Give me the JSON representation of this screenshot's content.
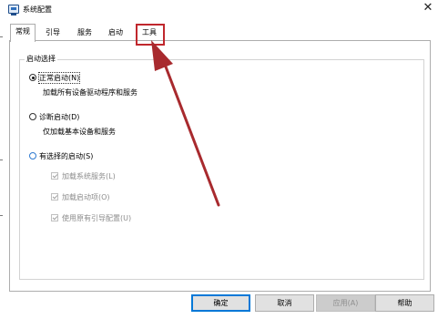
{
  "window": {
    "title": "系统配置",
    "close_glyph": "✕"
  },
  "tabs": [
    {
      "label": "常规",
      "active": true
    },
    {
      "label": "引导",
      "active": false
    },
    {
      "label": "服务",
      "active": false
    },
    {
      "label": "启动",
      "active": false
    },
    {
      "label": "工具",
      "active": false,
      "highlighted": true
    }
  ],
  "startup_selection": {
    "group_title": "启动选择",
    "options": [
      {
        "label": "正常启动(N)",
        "selected": true,
        "description": "加载所有设备驱动程序和服务"
      },
      {
        "label": "诊断启动(D)",
        "selected": false,
        "description": "仅加载基本设备和服务"
      },
      {
        "label": "有选择的启动(S)",
        "selected": false
      }
    ],
    "sub_options": [
      {
        "label": "加载系统服务(L)",
        "checked": true,
        "enabled": false
      },
      {
        "label": "加载启动项(O)",
        "checked": true,
        "enabled": false
      },
      {
        "label": "使用原有引导配置(U)",
        "checked": true,
        "enabled": false
      }
    ]
  },
  "buttons": {
    "ok": "确定",
    "cancel": "取消",
    "apply": "应用(A)",
    "help": "帮助"
  },
  "annotation": {
    "color": "#c0272d",
    "target": "tab-tools"
  },
  "colors": {
    "accent": "#0078d7",
    "annotation": "#c0272d"
  }
}
